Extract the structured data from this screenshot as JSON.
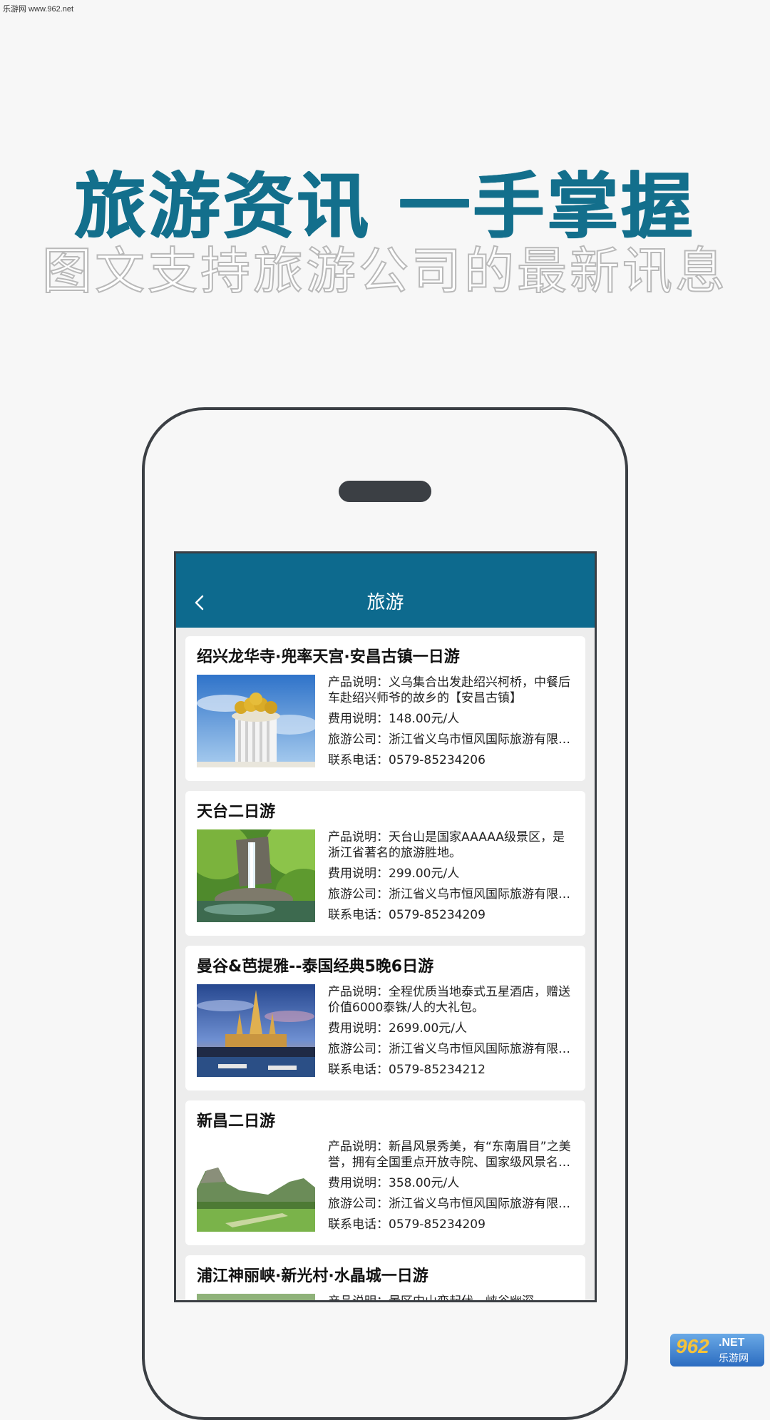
{
  "watermark": "乐游网 www.962.net",
  "headline": "旅游资讯  一手掌握",
  "subline": "图文支持旅游公司的最新讯息",
  "app": {
    "nav_title": "旅游",
    "back_icon": "chevron-left-icon"
  },
  "labels": {
    "desc": "产品说明：",
    "price": "费用说明：",
    "company": "旅游公司：",
    "phone": "联系电话："
  },
  "tours": [
    {
      "title": "绍兴龙华寺·兜率天宫·安昌古镇一日游",
      "desc": "义乌集合出发赴绍兴柯桥，中餐后车赴绍兴师爷的故乡的【安昌古镇】",
      "price": "148.00元/人",
      "company": "浙江省义乌市恒风国际旅游有限公司",
      "phone": "0579-85234206",
      "image": "temple-rotunda"
    },
    {
      "title": "天台二日游",
      "desc": "天台山是国家AAAAA级景区，是浙江省著名的旅游胜地。",
      "price": "299.00元/人",
      "company": "浙江省义乌市恒风国际旅游有限公司",
      "phone": "0579-85234209",
      "image": "waterfall"
    },
    {
      "title": "曼谷&芭提雅--泰国经典5晚6日游",
      "desc": "全程优质当地泰式五星酒店，赠送价值6000泰铢/人的大礼包。",
      "price": "2699.00元/人",
      "company": "浙江省义乌市恒风国际旅游有限公司",
      "phone": "0579-85234212",
      "image": "thai-temple-night"
    },
    {
      "title": "新昌二日游",
      "desc": "新昌风景秀美，有“东南眉目”之美誉，拥有全国重点开放寺院、国家级风景名胜区",
      "price": "358.00元/人",
      "company": "浙江省义乌市恒风国际旅游有限公司",
      "phone": "0579-85234209",
      "image": "mountain-meadow"
    },
    {
      "title": "浦江神丽峡·新光村·水晶城一日游",
      "desc": "景区内山峦起伏，峡谷幽深",
      "price": "",
      "company": "",
      "phone": "",
      "image": "gorge"
    }
  ],
  "logo": {
    "num": "962",
    "net": ".NET",
    "cn": "乐游网"
  },
  "colors": {
    "headline": "#136f8c",
    "navbar": "#0d6a8e",
    "frame": "#3b3f44"
  }
}
